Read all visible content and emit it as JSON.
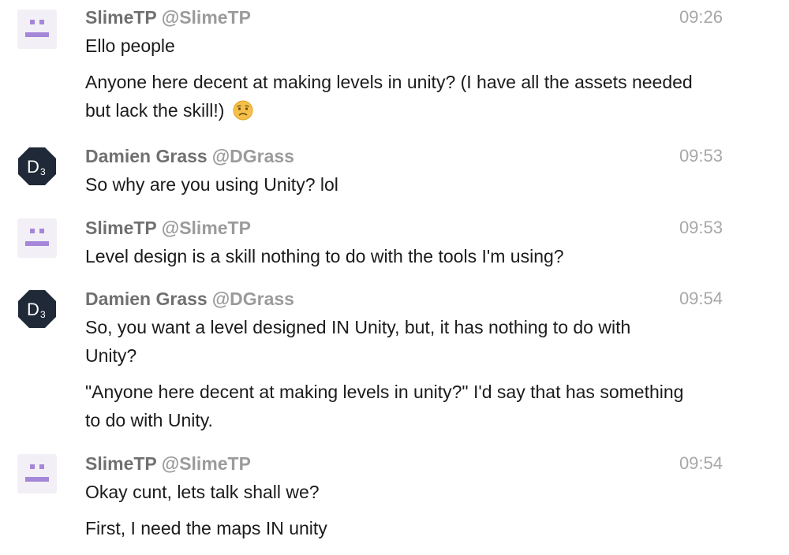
{
  "messages": [
    {
      "user": "SlimeTP",
      "handle": "@SlimeTP",
      "time": "09:26",
      "avatar": "slime-avatar-icon",
      "lines": [
        "Ello people",
        "Anyone here decent at making levels in unity? (I have all the assets needed",
        "but lack the skill!)"
      ],
      "emoji": "worried-face-emoji"
    },
    {
      "user": "Damien Grass",
      "handle": "@DGrass",
      "time": "09:53",
      "avatar": "d3-avatar-icon",
      "avatar_text": "D",
      "avatar_sub": "3",
      "lines": [
        "So why are you using Unity? lol"
      ]
    },
    {
      "user": "SlimeTP",
      "handle": "@SlimeTP",
      "time": "09:53",
      "avatar": "slime-avatar-icon",
      "lines": [
        "Level design is a skill nothing to do with the tools I'm using?"
      ]
    },
    {
      "user": "Damien Grass",
      "handle": "@DGrass",
      "time": "09:54",
      "avatar": "d3-avatar-icon",
      "avatar_text": "D",
      "avatar_sub": "3",
      "lines": [
        "So, you want a level designed IN Unity, but, it has nothing to do with",
        "Unity?",
        "\"Anyone here decent at making levels in unity?\" I'd say that has something",
        "to do with Unity."
      ]
    },
    {
      "user": "SlimeTP",
      "handle": "@SlimeTP",
      "time": "09:54",
      "avatar": "slime-avatar-icon",
      "lines": [
        "Okay cunt, lets talk shall we?",
        "First, I need the maps IN unity"
      ]
    }
  ],
  "colors": {
    "username": "#707070",
    "handle": "#9b9b9b",
    "timestamp": "#a8a8a8",
    "slime_avatar": "#a586d8",
    "damien_avatar": "#1f2937"
  }
}
